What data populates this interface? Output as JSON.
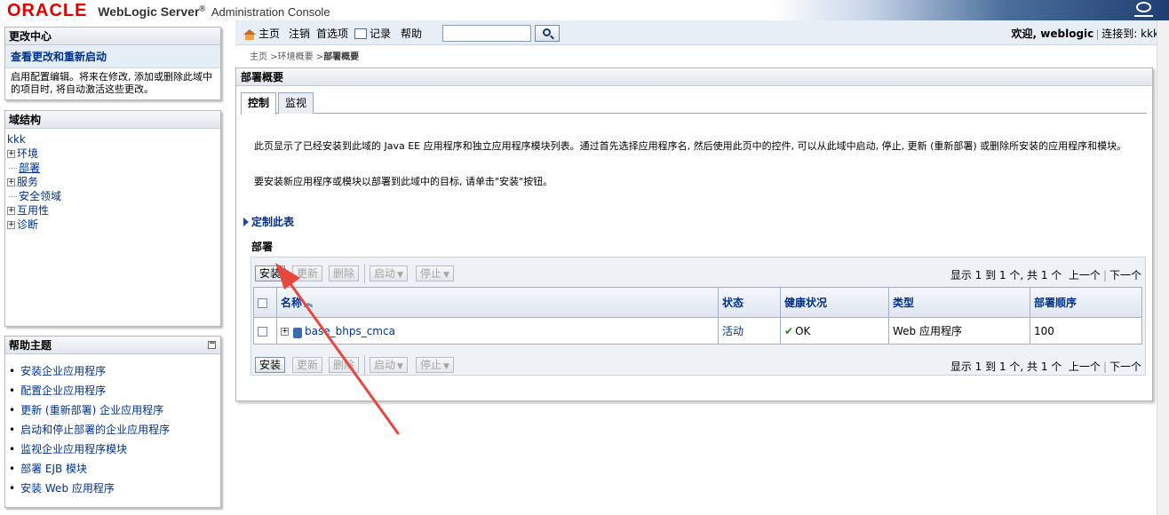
{
  "header": {
    "brand_oracle": "ORACLE",
    "brand_product": "WebLogic Server",
    "brand_reg": "®",
    "brand_console": "Administration Console"
  },
  "change_center": {
    "title": "更改中心",
    "link": "查看更改和重新启动",
    "text": "启用配置编辑。将来在修改, 添加或删除此域中的项目时, 将自动激活这些更改。"
  },
  "domain_structure": {
    "title": "域结构",
    "root": "kkk",
    "items": [
      {
        "label": "环境",
        "expandable": true
      },
      {
        "label": "部署",
        "expandable": false,
        "active": true
      },
      {
        "label": "服务",
        "expandable": true
      },
      {
        "label": "安全领域",
        "expandable": false
      },
      {
        "label": "互用性",
        "expandable": true
      },
      {
        "label": "诊断",
        "expandable": true
      }
    ]
  },
  "help": {
    "title": "帮助主题",
    "items": [
      "安装企业应用程序",
      "配置企业应用程序",
      "更新 (重新部署) 企业应用程序",
      "启动和停止部署的企业应用程序",
      "监视企业应用程序模块",
      "部署 EJB 模块",
      "安装 Web 应用程序"
    ]
  },
  "nav": {
    "home": "主页",
    "logout": "注销",
    "preferences": "首选项",
    "record": "记录",
    "help": "帮助",
    "search_value": "",
    "welcome": "欢迎, weblogic",
    "connected": "连接到: kkk"
  },
  "breadcrumb": {
    "home": "主页",
    "env": "环境概要",
    "current": "部署概要",
    "sep": ">"
  },
  "main": {
    "title": "部署概要",
    "tabs": [
      {
        "label": "控制",
        "active": true
      },
      {
        "label": "监视",
        "active": false
      }
    ],
    "description": "此页显示了已经安装到此域的 Java EE 应用程序和独立应用程序模块列表。通过首先选择应用程序名, 然后使用此页中的控件, 可以从此域中启动, 停止, 更新 (重新部署) 或删除所安装的应用程序和模块。",
    "install_hint": "要安装新应用程序或模块以部署到此域中的目标, 请单击\"安装\"按钮。",
    "customize": "定制此表",
    "section": "部署"
  },
  "toolbar": {
    "install": "安装",
    "update": "更新",
    "delete": "删除",
    "start": "启动",
    "stop": "停止",
    "pager_text": "显示 1 到 1 个, 共 1 个",
    "prev": "上一个",
    "next": "下一个"
  },
  "table": {
    "columns": [
      "名称",
      "状态",
      "健康状况",
      "类型",
      "部署顺序"
    ],
    "rows": [
      {
        "name": "base_bhps_cmca",
        "state": "活动",
        "health": "OK",
        "type": "Web 应用程序",
        "order": "100"
      }
    ]
  },
  "colors": {
    "link": "#00318c",
    "oracle_red": "#e00000",
    "annotation_arrow": "#e8473f"
  }
}
